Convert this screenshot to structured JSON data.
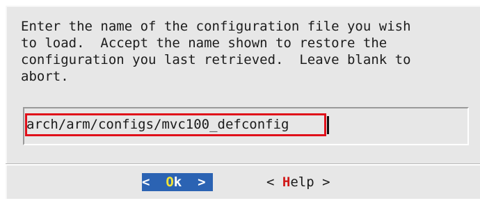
{
  "dialog": {
    "prompt": "Enter the name of the configuration file you wish\nto load.  Accept the name shown to restore the\nconfiguration you last retrieved.  Leave blank to\nabort.",
    "input_value": "arch/arm/configs/mvc100_defconfig"
  },
  "buttons": {
    "ok": {
      "prefix": "<  ",
      "hotkey": "O",
      "rest": "k  ",
      "suffix": ">"
    },
    "help": {
      "prefix": "< ",
      "hotkey": "H",
      "rest": "elp",
      "suffix": " >"
    }
  },
  "colors": {
    "dialog_bg": "#e7e7e7",
    "selected_button_bg": "#2b63b3",
    "selected_hotkey": "#f2e437",
    "hotkey": "#d01818",
    "highlight_box": "#e0101a"
  }
}
